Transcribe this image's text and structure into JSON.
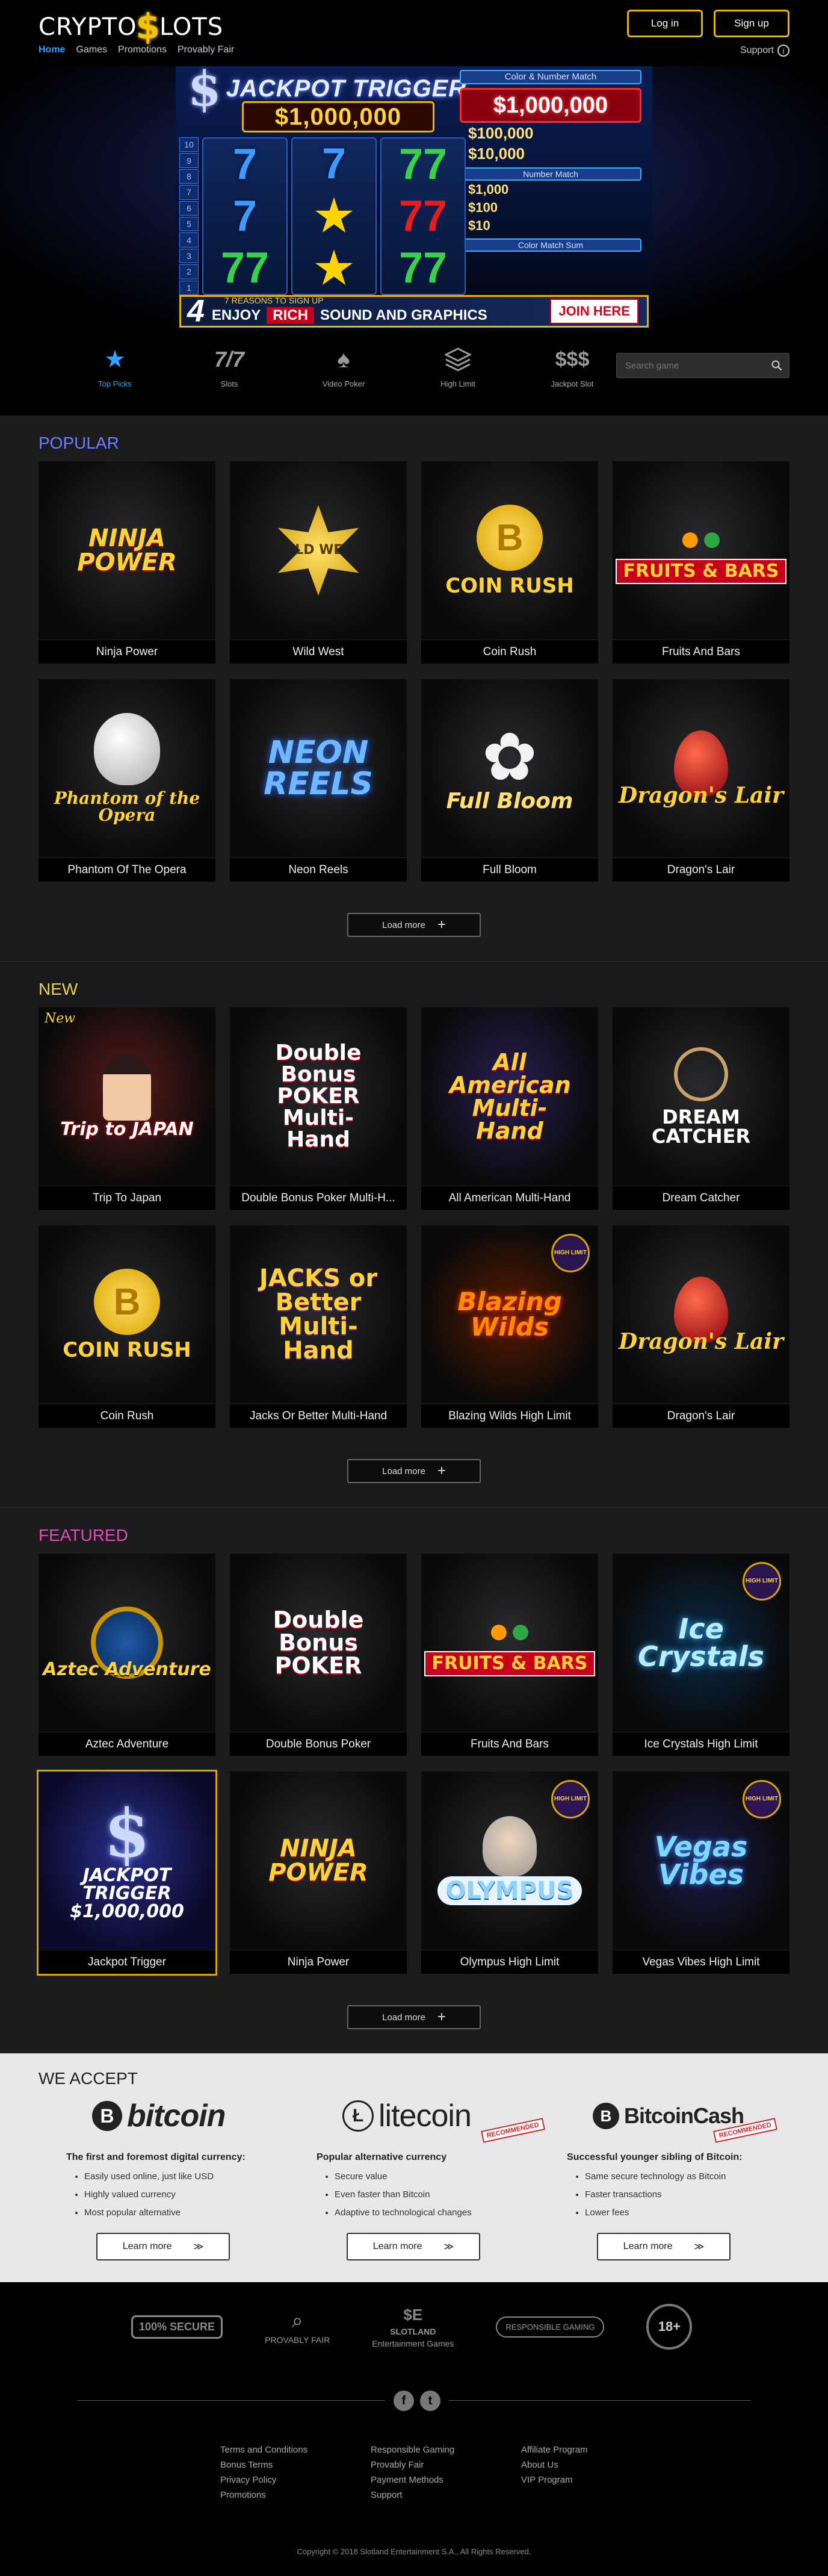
{
  "header": {
    "logo_pre": "CRYPTO",
    "logo_s": "$",
    "logo_post": "LOTS",
    "login": "Log in",
    "signup": "Sign up",
    "nav": [
      "Home",
      "Games",
      "Promotions",
      "Provably Fair"
    ],
    "support": "Support"
  },
  "banner": {
    "title": "JACKPOT TRIGGER",
    "amount": "$1,000,000",
    "color_number_match": "Color & Number Match",
    "big_red": "$1,000,000",
    "prize1": "$100,000",
    "prize2": "$10,000",
    "number_match": "Number Match",
    "prizes_small": [
      "$1,000",
      "$100",
      "$10"
    ],
    "color_match": "Color Match Sum",
    "lines": [
      "10",
      "9",
      "8",
      "7",
      "6",
      "5",
      "4",
      "3",
      "2",
      "1"
    ],
    "four": "4",
    "reasons": "7 REASONS TO SIGN UP",
    "enjoy": "ENJOY",
    "rich": "RICH",
    "sound": "SOUND AND GRAPHICS",
    "join": "JOIN HERE"
  },
  "categories": [
    {
      "label": "Top Picks",
      "icon": "star-icon"
    },
    {
      "label": "Slots",
      "icon": "sevens-icon"
    },
    {
      "label": "Video Poker",
      "icon": "spade-icon"
    },
    {
      "label": "High Limit",
      "icon": "layers-icon"
    },
    {
      "label": "Jackpot Slot",
      "icon": "dollars-icon"
    }
  ],
  "search": {
    "placeholder": "Search game"
  },
  "popular": {
    "title": "POPULAR",
    "games": [
      {
        "name": "Ninja Power",
        "art": "NINJA POWER"
      },
      {
        "name": "Wild West",
        "art": "WILD WEST"
      },
      {
        "name": "Coin Rush",
        "art": "COIN RUSH"
      },
      {
        "name": "Fruits And Bars",
        "art": "FRUITS & BARS"
      },
      {
        "name": "Phantom Of The Opera",
        "art": "Phantom of the Opera"
      },
      {
        "name": "Neon Reels",
        "art": "NEON REELS"
      },
      {
        "name": "Full Bloom",
        "art": "Full Bloom"
      },
      {
        "name": "Dragon's Lair",
        "art": "Dragon's Lair"
      }
    ],
    "load_more": "Load more"
  },
  "new": {
    "title": "NEW",
    "badge": "New",
    "games": [
      {
        "name": "Trip To Japan",
        "art": "Trip to JAPAN"
      },
      {
        "name": "Double Bonus Poker Multi-H...",
        "art": "Double Bonus POKER Multi-Hand"
      },
      {
        "name": "All American Multi-Hand",
        "art": "All American Multi-Hand"
      },
      {
        "name": "Dream Catcher",
        "art": "DREAM CATCHER"
      },
      {
        "name": "Coin Rush",
        "art": "COIN RUSH"
      },
      {
        "name": "Jacks Or Better Multi-Hand",
        "art": "JACKS or Better Multi-Hand"
      },
      {
        "name": "Blazing Wilds High Limit",
        "art": "Blazing Wilds"
      },
      {
        "name": "Dragon's Lair",
        "art": "Dragon's Lair"
      }
    ],
    "load_more": "Load more"
  },
  "featured": {
    "title": "FEATURED",
    "games": [
      {
        "name": "Aztec Adventure",
        "art": "Aztec Adventure"
      },
      {
        "name": "Double Bonus Poker",
        "art": "Double Bonus POKER"
      },
      {
        "name": "Fruits And Bars",
        "art": "FRUITS & BARS"
      },
      {
        "name": "Ice Crystals High Limit",
        "art": "Ice Crystals"
      },
      {
        "name": "Jackpot Trigger",
        "art": "JACKPOT TRIGGER $1,000,000"
      },
      {
        "name": "Ninja Power",
        "art": "NINJA POWER"
      },
      {
        "name": "Olympus High Limit",
        "art": "OLYMPUS"
      },
      {
        "name": "Vegas Vibes High Limit",
        "art": "Vegas Vibes"
      }
    ],
    "load_more": "Load more"
  },
  "high_limit_badge": "HIGH LIMIT",
  "accept": {
    "title": "WE ACCEPT",
    "recommended": "RECOMMENDED",
    "learn_more": "Learn more",
    "coins": [
      {
        "name": "bitcoin",
        "heading": "The first and foremost digital currency:",
        "points": [
          "Easily used online, just like USD",
          "Highly valued currency",
          "Most popular alternative"
        ]
      },
      {
        "name": "litecoin",
        "heading": "Popular alternative currency",
        "points": [
          "Secure value",
          "Even faster than Bitcoin",
          "Adaptive to technological changes"
        ]
      },
      {
        "name": "BitcoinCash",
        "heading": "Successful younger sibling of Bitcoin:",
        "points": [
          "Same secure technology as Bitcoin",
          "Faster transactions",
          "Lower fees"
        ]
      }
    ]
  },
  "footer": {
    "trust": [
      "100% SECURE",
      "PROVABLY FAIR",
      "SLOTLAND",
      "Entertainment Games",
      "RESPONSIBLE GAMING",
      "18+"
    ],
    "links": [
      [
        "Terms and Conditions",
        "Responsible Gaming",
        "Affiliate Program"
      ],
      [
        "Bonus Terms",
        "Provably Fair",
        "About Us"
      ],
      [
        "Privacy Policy",
        "Payment Methods",
        "VIP Program"
      ],
      [
        "Promotions",
        "Support",
        ""
      ]
    ],
    "copyright": "Copyright © 2018 Slotland Entertainment S.A., All Rights Reserved."
  }
}
